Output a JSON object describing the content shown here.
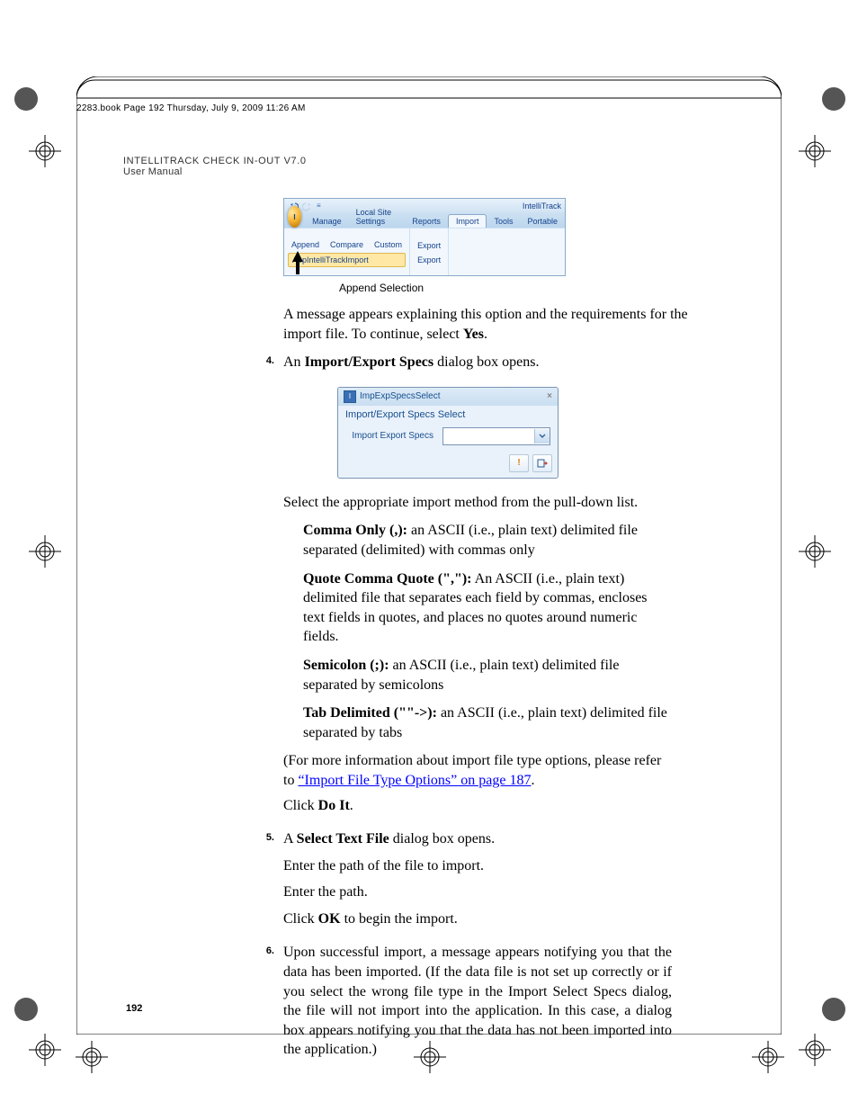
{
  "header_line": "2283.book  Page 192  Thursday, July 9, 2009  11:26 AM",
  "title_line1": "INTELLITRACK CHECK IN-OUT V7.0",
  "title_line2": "User Manual",
  "ribbon": {
    "brand": "IntelliTrack",
    "tabs": [
      "Manage",
      "Local Site Settings",
      "Reports",
      "Import",
      "Tools",
      "Portable"
    ],
    "group1": [
      "Append",
      "Compare",
      "Custom"
    ],
    "group1b": "AppIntelliTrackImport",
    "group2": [
      "Export",
      "Export"
    ]
  },
  "append_caption": "Append Selection",
  "para_after_ribbon_1": "A message appears explaining this option and the requirements for the import file. To continue, select ",
  "para_after_ribbon_yes": "Yes",
  "step4_num": "4.",
  "step4_a": "An ",
  "step4_b": "Import/Export Specs",
  "step4_c": " dialog box opens.",
  "dialog": {
    "title": "ImpExpSpecsSelect",
    "sub": "Import/Export Specs Select",
    "label": "Import Export Specs",
    "btn1": "!",
    "btn2": "▸"
  },
  "after_dialog": "Select the appropriate import method from the pull-down list.",
  "opt1_b": "Comma Only (,):",
  "opt1_t": " an ASCII (i.e., plain text) delimited file separated (delimited) with commas only",
  "opt2_b": "Quote Comma Quote (\",\"):",
  "opt2_t": " An ASCII (i.e., plain text) delimited file that separates each field by commas, encloses text fields in quotes, and places no quotes around numeric fields.",
  "opt3_b": "Semicolon (;):",
  "opt3_t": " an ASCII (i.e., plain text) delimited file separated by semicolons",
  "opt4_b": "Tab Delimited  (\"\"->):",
  "opt4_t": " an ASCII (i.e., plain text) delimited file separated by tabs",
  "more_info_a": "(For more information about import file type options, please refer to ",
  "more_info_link": "“Import File Type Options” on page 187",
  "more_info_b": ".",
  "click_doit_a": "Click ",
  "click_doit_b": "Do It",
  "click_doit_c": ".",
  "step5_num": "5.",
  "step5_a": "A ",
  "step5_b": "Select Text File",
  "step5_c": " dialog box opens.",
  "step5_p1": "Enter the path of the file to import.",
  "step5_p2": "Enter the path.",
  "step5_p3a": "Click ",
  "step5_p3b": "OK",
  "step5_p3c": " to begin the import.",
  "step6_num": "6.",
  "step6_text": "Upon successful import, a message appears notifying you that the data has been imported. (If the data file is not set up correctly or if you select the wrong file type in the Import Select Specs dialog, the file will not import into the application. In this case, a dialog box appears notifying you that the data has not been imported into the application.)",
  "page_number": "192"
}
